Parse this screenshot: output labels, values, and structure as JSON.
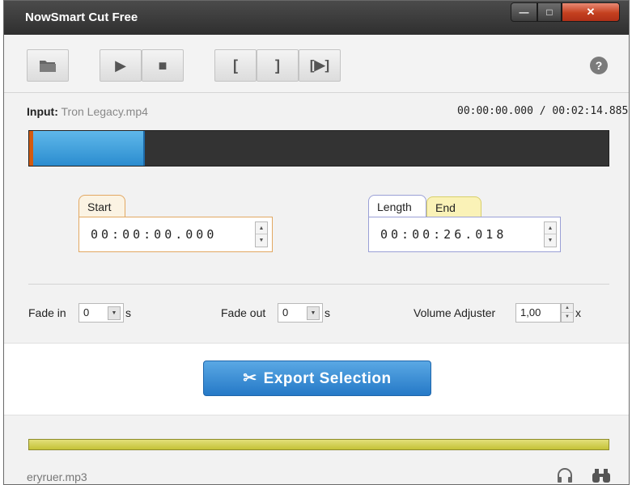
{
  "app": {
    "title": "NowSmart Cut Free"
  },
  "window_controls": {
    "minimize": "—",
    "maximize": "□",
    "close": "✕"
  },
  "toolbar": {
    "open_icon": "folder-icon",
    "play_label": "▶",
    "stop_label": "■",
    "mark_in_label": "[",
    "mark_out_label": "]",
    "play_selection_label": "[▶]",
    "help_label": "?"
  },
  "input": {
    "label": "Input:",
    "filename": "Tron Legacy.mp4",
    "timecode": "00:00:00.000 / 00:02:14.885"
  },
  "timeline": {
    "selection_start_fraction": 0.0,
    "selection_end_fraction": 0.193
  },
  "start": {
    "tab": "Start",
    "value": "00:00:00.000"
  },
  "length": {
    "tab": "Length",
    "end_tab": "End",
    "value": "00:00:26.018"
  },
  "fade_in": {
    "label": "Fade in",
    "value": "0",
    "unit": "s"
  },
  "fade_out": {
    "label": "Fade out",
    "value": "0",
    "unit": "s"
  },
  "volume": {
    "label": "Volume Adjuster",
    "value": "1,00",
    "unit": "x"
  },
  "export": {
    "label": "Export Selection"
  },
  "output": {
    "filename": "eryruer.mp3",
    "progress_fraction": 1.0
  },
  "colors": {
    "accent": "#2b8ccf",
    "titlebar": "#3a3a3a",
    "close": "#c4401f",
    "output_bar": "#cfcd4a"
  }
}
